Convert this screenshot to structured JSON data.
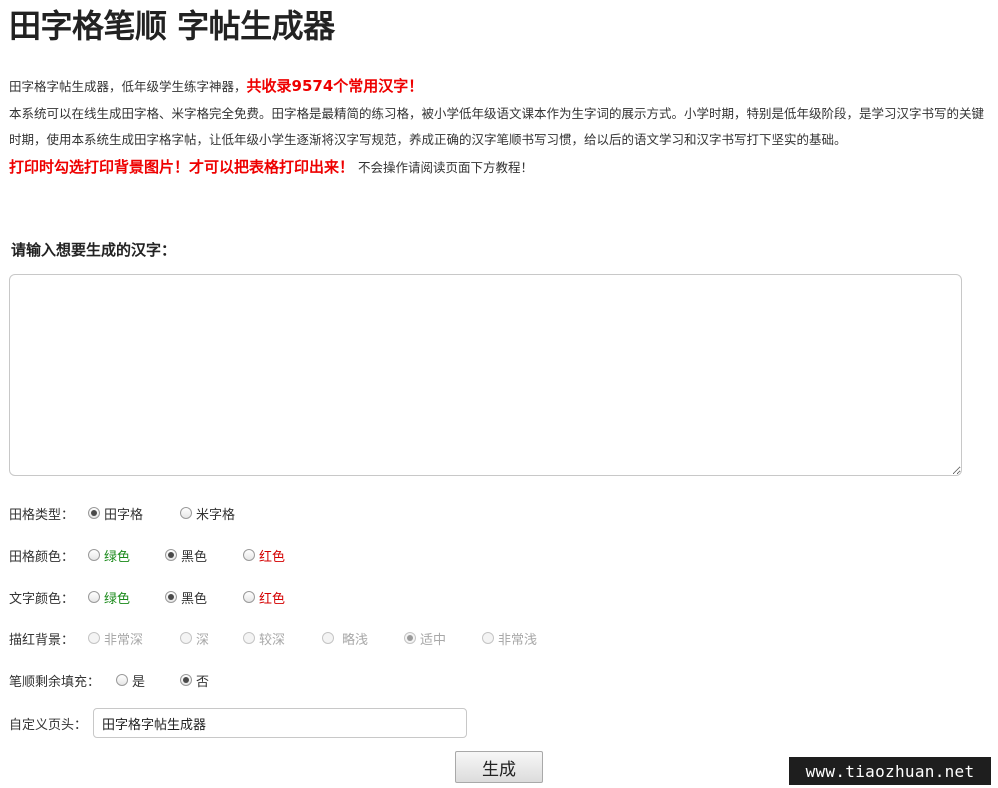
{
  "page": {
    "title": "田字格笔顺 字帖生成器"
  },
  "intro": {
    "line1_text": "田字格字帖生成器，低年级学生练字神器，",
    "line1_highlight": "共收录9574个常用汉字！",
    "paragraph": "本系统可以在线生成田字格、米字格完全免费。田字格是最精简的练习格，被小学低年级语文课本作为生字词的展示方式。小学时期，特别是低年级阶段，是学习汉字书写的关键时期，使用本系统生成田字格字帖，让低年级小学生逐渐将汉字写规范，养成正确的汉字笔顺书写习惯，给以后的语文学习和汉字书写打下坚实的基础。",
    "print_note": "打印时勾选打印背景图片！才可以把表格打印出来！",
    "print_note_tail": "不会操作请阅读页面下方教程！"
  },
  "input": {
    "heading": "请输入想要生成的汉字：",
    "value": ""
  },
  "options": {
    "grid_type": {
      "label": "田格类型：",
      "choices": [
        "田字格",
        "米字格"
      ],
      "selected": "田字格"
    },
    "grid_color": {
      "label": "田格颜色：",
      "choices": [
        "绿色",
        "黑色",
        "红色"
      ],
      "selected": "黑色"
    },
    "text_color": {
      "label": "文字颜色：",
      "choices": [
        "绿色",
        "黑色",
        "红色"
      ],
      "selected": "黑色"
    },
    "trace_background": {
      "label": "描红背景：",
      "choices": [
        "非常深",
        "深",
        "较深",
        "略浅",
        "适中",
        "非常浅"
      ],
      "selected": "适中",
      "disabled": true
    },
    "stroke_fill": {
      "label": "笔顺剩余填充：",
      "choices": [
        "是",
        "否"
      ],
      "selected": "否"
    },
    "custom_header": {
      "label": "自定义页头：",
      "value": "田字格字帖生成器"
    }
  },
  "actions": {
    "generate_label": "生成"
  },
  "watermark": {
    "text": "www.tiaozhuan.net"
  },
  "colors": {
    "accent_red": "#ee0000",
    "green": "#1a8a1a",
    "red": "#d40000",
    "disabled_text": "#a8a8a8"
  }
}
